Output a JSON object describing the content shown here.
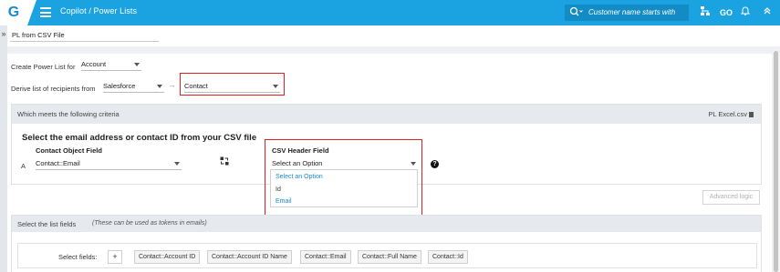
{
  "topbar": {
    "logo": "G",
    "menu_icon": "hamburger-icon",
    "title": "Copilot / Power Lists",
    "search_placeholder": "Customer name starts with",
    "icons": [
      "search-icon",
      "hierarchy-icon",
      "go-icon",
      "bell-icon",
      "chevrons-up-icon"
    ],
    "go_label": "GO"
  },
  "colors": {
    "brand": "#1aa3e0",
    "highlight": "#e02020",
    "link": "#1a8ad0"
  },
  "power_list_name": "PL from CSV File",
  "create_for": {
    "label": "Create Power List for",
    "value": "Account"
  },
  "derive": {
    "label": "Derive list of recipients from",
    "source": "Salesforce",
    "arrow": "→",
    "object": "Contact"
  },
  "criteria": {
    "heading": "Which meets the following criteria",
    "file_name": "PL Excel.csv",
    "instruction": "Select the email address or contact ID from your CSV file",
    "contact_field_label": "Contact Object Field",
    "row_letter": "A",
    "contact_field_value": "Contact::Email",
    "csv_header_label": "CSV Header Field",
    "csv_header_placeholder": "Select an Option",
    "csv_options": [
      "Select an Option",
      "Id",
      "Email"
    ],
    "advanced_logic": "Advanced logic"
  },
  "list_fields": {
    "heading": "Select the list fields",
    "hint": "(These can be used as tokens in emails)",
    "select_label": "Select fields:",
    "add_label": "+",
    "chips": [
      "Contact::Account ID",
      "Contact::Account ID Name",
      "Contact::Email",
      "Contact::Full Name",
      "Contact::Id"
    ]
  }
}
